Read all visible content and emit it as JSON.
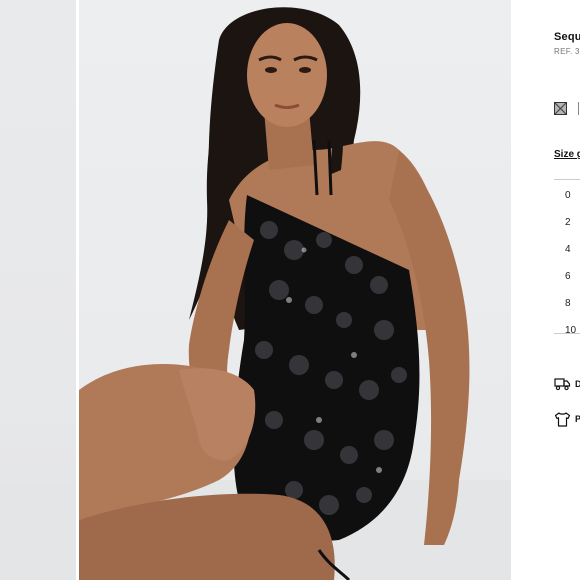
{
  "gallery": {
    "thumbnail_alt": "Product image thumbnail",
    "main_image_alt": "Model in black sequin mini dress"
  },
  "product": {
    "title": "Sequ",
    "reference": "REF. 3",
    "color_swatch": {
      "name": "black-sequin-swatch",
      "color": "#222222"
    }
  },
  "sizes": {
    "guide_label": "Size g",
    "options": [
      "0",
      "2",
      "4",
      "6",
      "8",
      "10"
    ]
  },
  "info": {
    "delivery": {
      "icon": "truck-icon",
      "label": "D"
    },
    "returns": {
      "icon": "shirt-icon",
      "label": "P"
    }
  },
  "colors": {
    "dress": "#0f0f10",
    "skin": "#b07a58",
    "hair": "#1c1410",
    "background": "#eaebed"
  }
}
